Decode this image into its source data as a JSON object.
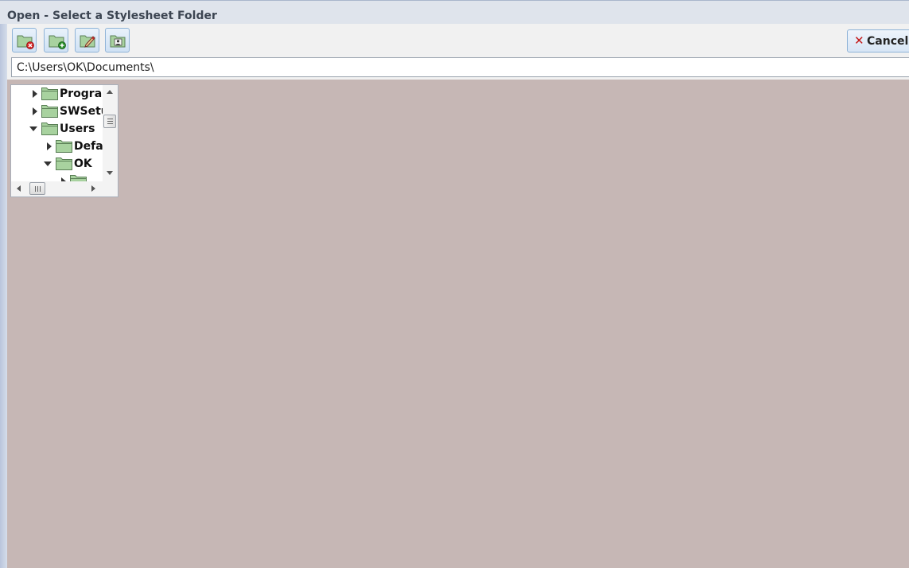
{
  "window": {
    "title": "Open - Select a Stylesheet Folder"
  },
  "toolbar": {
    "buttons": [
      {
        "icon": "folder-delete-icon"
      },
      {
        "icon": "folder-add-icon"
      },
      {
        "icon": "folder-rename-icon"
      },
      {
        "icon": "user-folder-icon"
      }
    ],
    "cancel_label": "Cancel",
    "cancel_icon": "close-icon"
  },
  "path": {
    "value": "C:\\Users\\OK\\Documents\\"
  },
  "tree": {
    "items": [
      {
        "label": "Prograr",
        "state": "collapsed",
        "depth": 0
      },
      {
        "label": "SWSetu",
        "state": "collapsed",
        "depth": 0
      },
      {
        "label": "Users",
        "state": "expanded",
        "depth": 0
      },
      {
        "label": "Defau",
        "state": "collapsed",
        "depth": 1
      },
      {
        "label": "OK",
        "state": "expanded",
        "depth": 1
      }
    ]
  },
  "colors": {
    "background": "#c6b7b5",
    "folder_fill": "#a8d29f",
    "accent_border": "#8fb3d7",
    "cancel_x": "#c41818"
  }
}
